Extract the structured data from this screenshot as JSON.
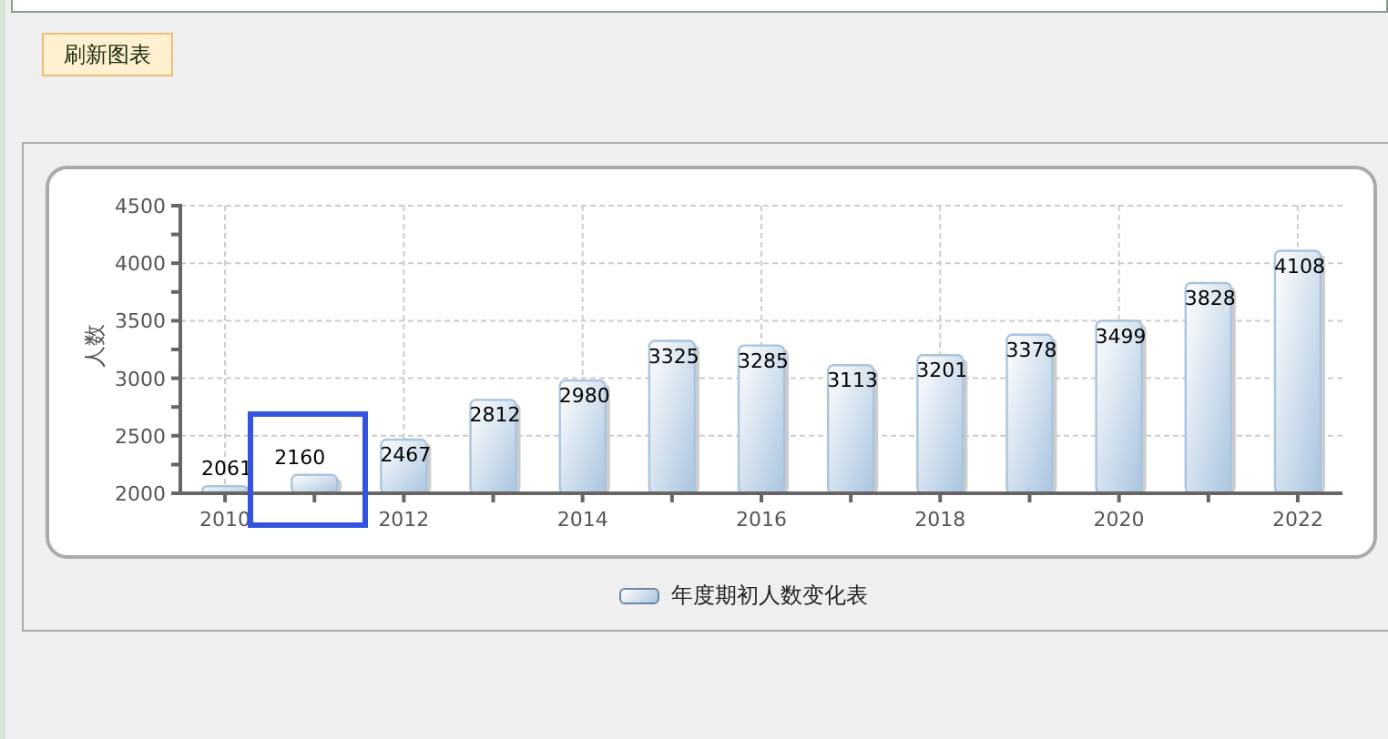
{
  "refresh_button": {
    "label": "刷新图表"
  },
  "chart": {
    "highlight_box": true,
    "chart_data": {
      "type": "bar",
      "ylabel": "人数",
      "x": [
        2010,
        2011,
        2012,
        2013,
        2014,
        2015,
        2016,
        2017,
        2018,
        2019,
        2020,
        2021,
        2022
      ],
      "series": [
        {
          "name": "年度期初人数变化表",
          "color": "#a9c4de",
          "values": [
            2061,
            2160,
            2467,
            2812,
            2980,
            3325,
            3285,
            3113,
            3201,
            3378,
            3499,
            3828,
            4108
          ]
        }
      ],
      "xlim": [
        2009.5,
        2022.5
      ],
      "ylim": [
        2000,
        4500
      ],
      "xticks": [
        2010,
        2012,
        2014,
        2016,
        2018,
        2020,
        2022
      ],
      "yticks": [
        2000,
        2500,
        3000,
        3500,
        4000,
        4500
      ],
      "grid": true,
      "data_labels": true
    }
  }
}
